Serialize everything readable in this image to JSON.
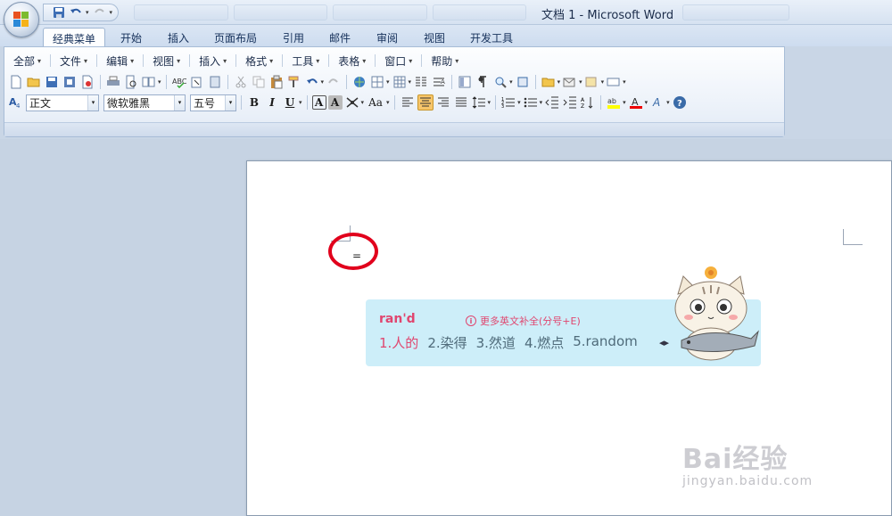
{
  "window": {
    "title": "文档 1 - Microsoft Word"
  },
  "ribbon_tabs": [
    {
      "label": "经典菜单",
      "active": true
    },
    {
      "label": "开始"
    },
    {
      "label": "插入"
    },
    {
      "label": "页面布局"
    },
    {
      "label": "引用"
    },
    {
      "label": "邮件"
    },
    {
      "label": "审阅"
    },
    {
      "label": "视图"
    },
    {
      "label": "开发工具"
    }
  ],
  "menus": [
    "全部",
    "文件",
    "编辑",
    "视图",
    "插入",
    "格式",
    "工具",
    "表格",
    "窗口",
    "帮助"
  ],
  "format_bar": {
    "style": "正文",
    "font": "微软雅黑",
    "size": "五号",
    "bold": "B",
    "italic": "I",
    "underline": "U",
    "char_border": "A",
    "char_shading": "A",
    "change_case": "Aa"
  },
  "document": {
    "typed_text": "="
  },
  "ime": {
    "composition": "ran'd",
    "tip": "更多英文补全(分号+E)",
    "candidates": [
      "1.人的",
      "2.染得",
      "3.然道",
      "4.燃点",
      "5.random"
    ]
  },
  "watermark": {
    "brand": "Bai经验",
    "url": "jingyan.baidu.com"
  },
  "colors": {
    "accent_red": "#e1001c",
    "ime_pink": "#e0466f",
    "ime_bg": "#cdeef9"
  }
}
